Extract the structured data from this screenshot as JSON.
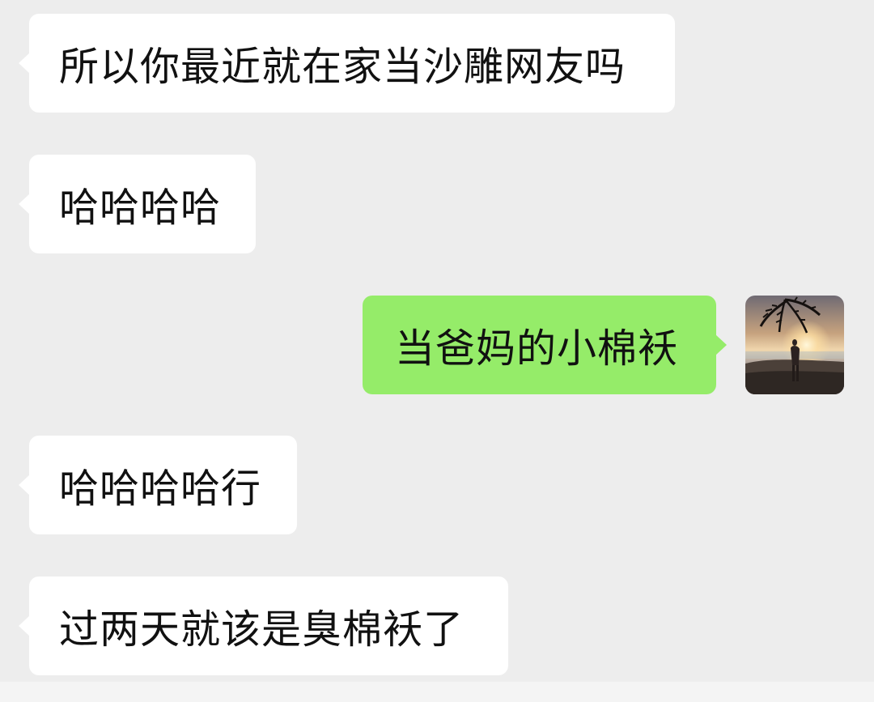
{
  "messages": [
    {
      "direction": "incoming",
      "text": "所以你最近就在家当沙雕网友吗"
    },
    {
      "direction": "incoming",
      "text": "哈哈哈哈"
    },
    {
      "direction": "outgoing",
      "text": "当爸妈的小棉袄"
    },
    {
      "direction": "incoming",
      "text": "哈哈哈哈行"
    },
    {
      "direction": "incoming",
      "text": "过两天就该是臭棉袄了"
    }
  ],
  "avatar": {
    "icon": "sunset-beach-photo-avatar"
  },
  "colors": {
    "background": "#ededed",
    "incoming_bubble": "#ffffff",
    "outgoing_bubble": "#95ec69",
    "text": "#111111"
  }
}
